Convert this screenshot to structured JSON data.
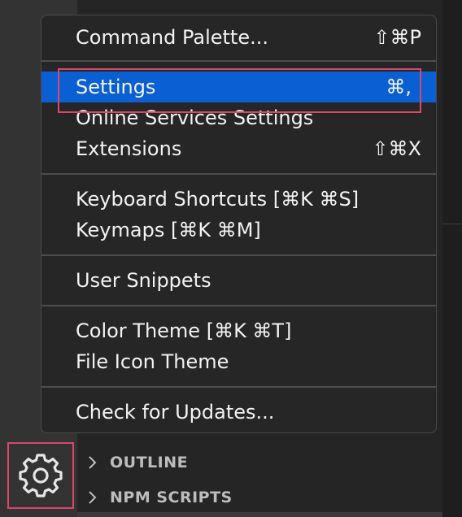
{
  "menu": {
    "items": [
      {
        "label": "Command Palette...",
        "shortcut": "⇧⌘P"
      },
      {
        "label": "Settings",
        "shortcut": "⌘,"
      },
      {
        "label": "Online Services Settings",
        "shortcut": ""
      },
      {
        "label": "Extensions",
        "shortcut": "⇧⌘X"
      },
      {
        "label": "Keyboard Shortcuts [⌘K ⌘S]",
        "shortcut": ""
      },
      {
        "label": "Keymaps [⌘K ⌘M]",
        "shortcut": ""
      },
      {
        "label": "User Snippets",
        "shortcut": ""
      },
      {
        "label": "Color Theme [⌘K ⌘T]",
        "shortcut": ""
      },
      {
        "label": "File Icon Theme",
        "shortcut": ""
      },
      {
        "label": "Check for Updates...",
        "shortcut": ""
      }
    ],
    "selected_item": "Settings"
  },
  "sidebar": {
    "sections": [
      {
        "label": "OUTLINE"
      },
      {
        "label": "NPM SCRIPTS"
      }
    ]
  },
  "activity_bar": {
    "manage_icon": "gear-icon"
  },
  "colors": {
    "selection": "#0a60d3",
    "highlight_box": "#d9476b",
    "menu_background": "#262626"
  }
}
